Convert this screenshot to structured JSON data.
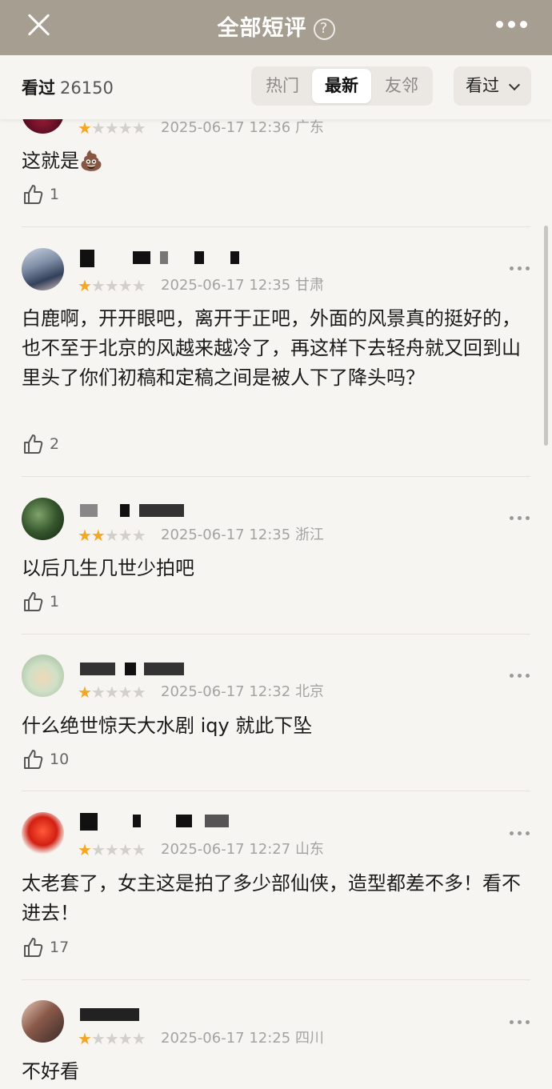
{
  "header": {
    "title": "全部短评",
    "help_icon": "question-icon",
    "close_icon": "close-icon",
    "more_icon": "more-icon"
  },
  "filters": {
    "seen_label": "看过",
    "seen_count": "26150",
    "tabs": [
      {
        "label": "热门",
        "active": false
      },
      {
        "label": "最新",
        "active": true
      },
      {
        "label": "友邻",
        "active": false
      }
    ],
    "dropdown_label": "看过"
  },
  "reviews": [
    {
      "stars": 1,
      "time": "2025-06-17 12:36",
      "location": "广东",
      "text": "这就是💩",
      "likes": "1"
    },
    {
      "stars": 1,
      "time": "2025-06-17 12:35",
      "location": "甘肃",
      "text": "白鹿啊，开开眼吧，离开于正吧，外面的风景真的挺好的，也不至于北京的风越来越冷了，再这样下去轻舟就又回到山里头了你们初稿和定稿之间是被人下了降头吗？",
      "likes": "2"
    },
    {
      "stars": 2,
      "time": "2025-06-17 12:35",
      "location": "浙江",
      "text": "以后几生几世少拍吧",
      "likes": "1"
    },
    {
      "stars": 1,
      "time": "2025-06-17 12:32",
      "location": "北京",
      "text": "什么绝世惊天大水剧 iqy 就此下坠",
      "likes": "10"
    },
    {
      "stars": 1,
      "time": "2025-06-17 12:27",
      "location": "山东",
      "text": "太老套了，女主这是拍了多少部仙侠，造型都差不多！看不进去！",
      "likes": "17"
    },
    {
      "stars": 1,
      "time": "2025-06-17 12:25",
      "location": "四川",
      "text": "不好看",
      "likes": ""
    }
  ],
  "colors": {
    "header_bg": "#a79e92",
    "star_on": "#f5a623",
    "star_off": "#d3d0cb",
    "page_bg": "#f7f5f1"
  }
}
